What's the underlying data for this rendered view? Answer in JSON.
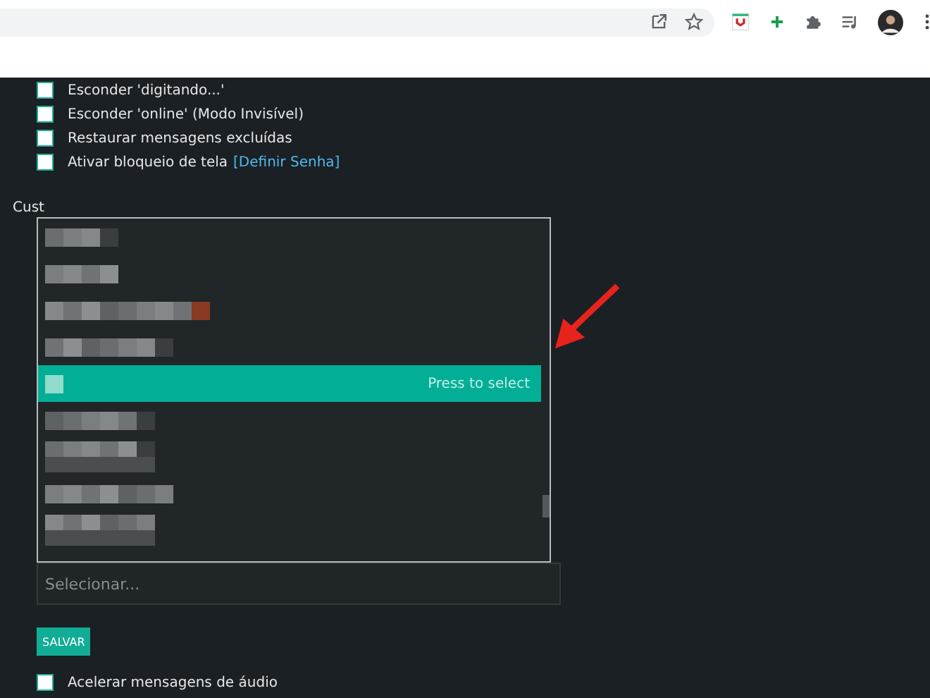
{
  "options_top": [
    {
      "label": "Esconder 'digitando...'",
      "checked": false
    },
    {
      "label": "Esconder 'online' (Modo Invisível)",
      "checked": false
    },
    {
      "label": "Restaurar mensagens excluídas",
      "checked": false
    },
    {
      "label": "Ativar bloqueio de tela",
      "link": "[Definir Senha]",
      "checked": false
    }
  ],
  "section_label": "Cust",
  "dropdown": {
    "select_hint": "Press to select",
    "options": [
      {
        "selected": false
      },
      {
        "selected": false
      },
      {
        "selected": false
      },
      {
        "selected": false
      },
      {
        "selected": true
      },
      {
        "selected": false
      },
      {
        "selected": false
      },
      {
        "selected": false
      },
      {
        "selected": false
      }
    ]
  },
  "search": {
    "placeholder": "Selecionar..."
  },
  "save_button": "SALVAR",
  "options_bottom": [
    {
      "label": "Acelerar mensagens de áudio",
      "checked": false
    }
  ]
}
